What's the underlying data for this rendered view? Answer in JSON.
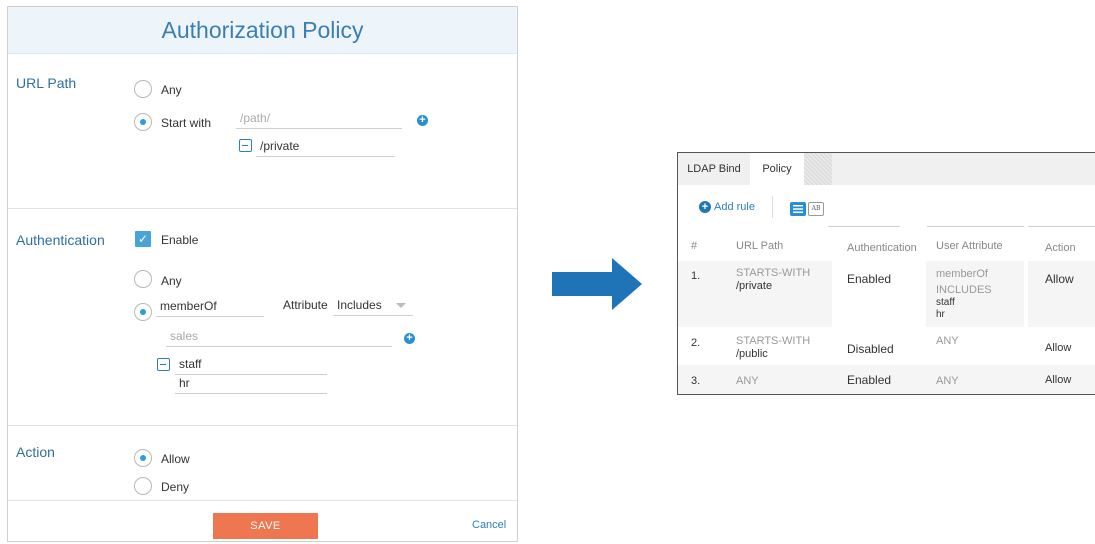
{
  "dialog": {
    "title": "Authorization Policy",
    "url_path": {
      "label": "URL Path",
      "opt_any": "Any",
      "opt_start_with": "Start with",
      "path_placeholder": "/path/",
      "path_entries": [
        "/private"
      ]
    },
    "authentication": {
      "label": "Authentication",
      "enable_label": "Enable",
      "opt_any": "Any",
      "attribute_name": "memberOf",
      "attribute_label": "Attribute",
      "operator_value": "Includes",
      "value_placeholder": "sales",
      "values": [
        "staff",
        "hr"
      ]
    },
    "action": {
      "label": "Action",
      "opt_allow": "Allow",
      "opt_deny": "Deny"
    },
    "footer": {
      "save_label": "SAVE",
      "cancel_label": "Cancel"
    }
  },
  "panel": {
    "tabs": [
      "LDAP Bind",
      "Policy"
    ],
    "add_rule_label": "Add rule",
    "toolbar_icon2_text": "AB",
    "columns": [
      "#",
      "URL Path",
      "Authentication",
      "User Attribute",
      "Action"
    ],
    "rows": [
      {
        "num": "1.",
        "url_prefix": "STARTS-WITH",
        "url_value": "/private",
        "auth": "Enabled",
        "attr_name": "memberOf",
        "attr_op": "INCLUDES",
        "attr_values": [
          "staff",
          "hr"
        ],
        "action": "Allow"
      },
      {
        "num": "2.",
        "url_prefix": "STARTS-WITH",
        "url_value": "/public",
        "auth": "Disabled",
        "attr_any": "ANY",
        "action": "Allow"
      },
      {
        "num": "3.",
        "url_any": "ANY",
        "auth": "Enabled",
        "attr_any": "ANY",
        "action": "Allow"
      }
    ]
  },
  "colors": {
    "accent_blue": "#2a7fc0",
    "save_orange": "#ee7650",
    "arrow_blue": "#1f74b8",
    "header_bg": "#edf5fa"
  }
}
